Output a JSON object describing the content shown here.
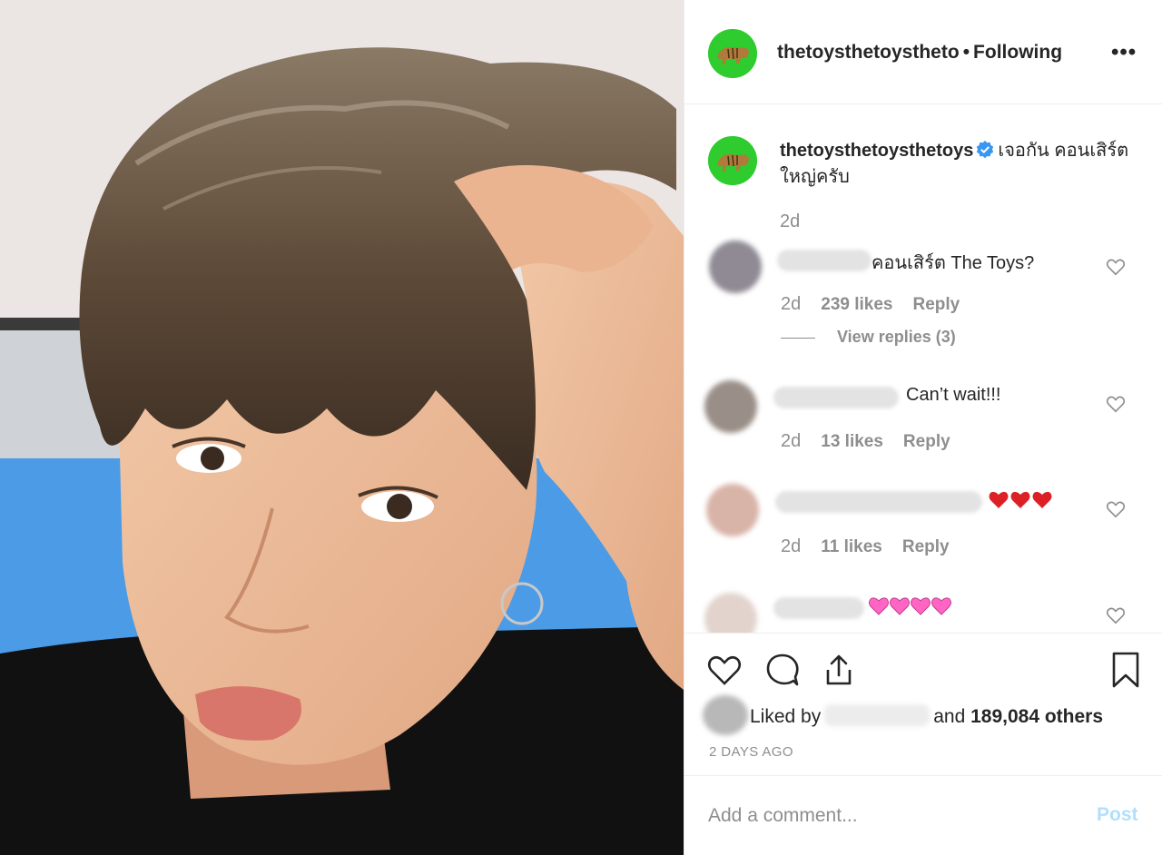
{
  "post": {
    "header": {
      "username": "thetoysthetoysthetoys",
      "username_display": "thetoysthetoystheto",
      "separator": "•",
      "follow_status": "Following",
      "more_icon": "more-horizontal-icon",
      "more_label": "•••"
    },
    "caption": {
      "username": "thetoysthetoysthetoys",
      "verified_icon": "verified-badge-icon",
      "text": "เจอกัน คอนเสิร์ตใหญ่ครับ",
      "time": "2d"
    },
    "comments": [
      {
        "text": "คอนเสิร์ต The Toys?",
        "time": "2d",
        "likes": "239 likes",
        "reply": "Reply",
        "view_replies": "View replies (3)",
        "avatar_color": "#8f8a94"
      },
      {
        "text": "Can’t wait!!!",
        "time": "2d",
        "likes": "13 likes",
        "reply": "Reply",
        "avatar_color": "#9a8f88"
      },
      {
        "text": "",
        "emoji": "red-hearts",
        "time": "2d",
        "likes": "11 likes",
        "reply": "Reply",
        "avatar_color": "#d8b3a8"
      },
      {
        "text": "",
        "emoji": "pink-hearts",
        "avatar_color": "#e2d3cd"
      }
    ],
    "actions": {
      "like_icon": "heart-icon",
      "comment_icon": "comment-icon",
      "share_icon": "share-icon",
      "save_icon": "bookmark-icon"
    },
    "likes": {
      "prefix": "Liked by",
      "and": "and",
      "others": "189,084 others"
    },
    "date": "2 DAYS AGO",
    "add_comment": {
      "placeholder": "Add a comment...",
      "post_label": "Post"
    }
  },
  "colors": {
    "avatar_bg": "#2ecc2e",
    "verified": "#3897f0",
    "muted_text": "#8e8e8e",
    "post_button": "#b2dffc",
    "red_heart": "#dd1f26",
    "pink_heart": "#ff66c4"
  }
}
